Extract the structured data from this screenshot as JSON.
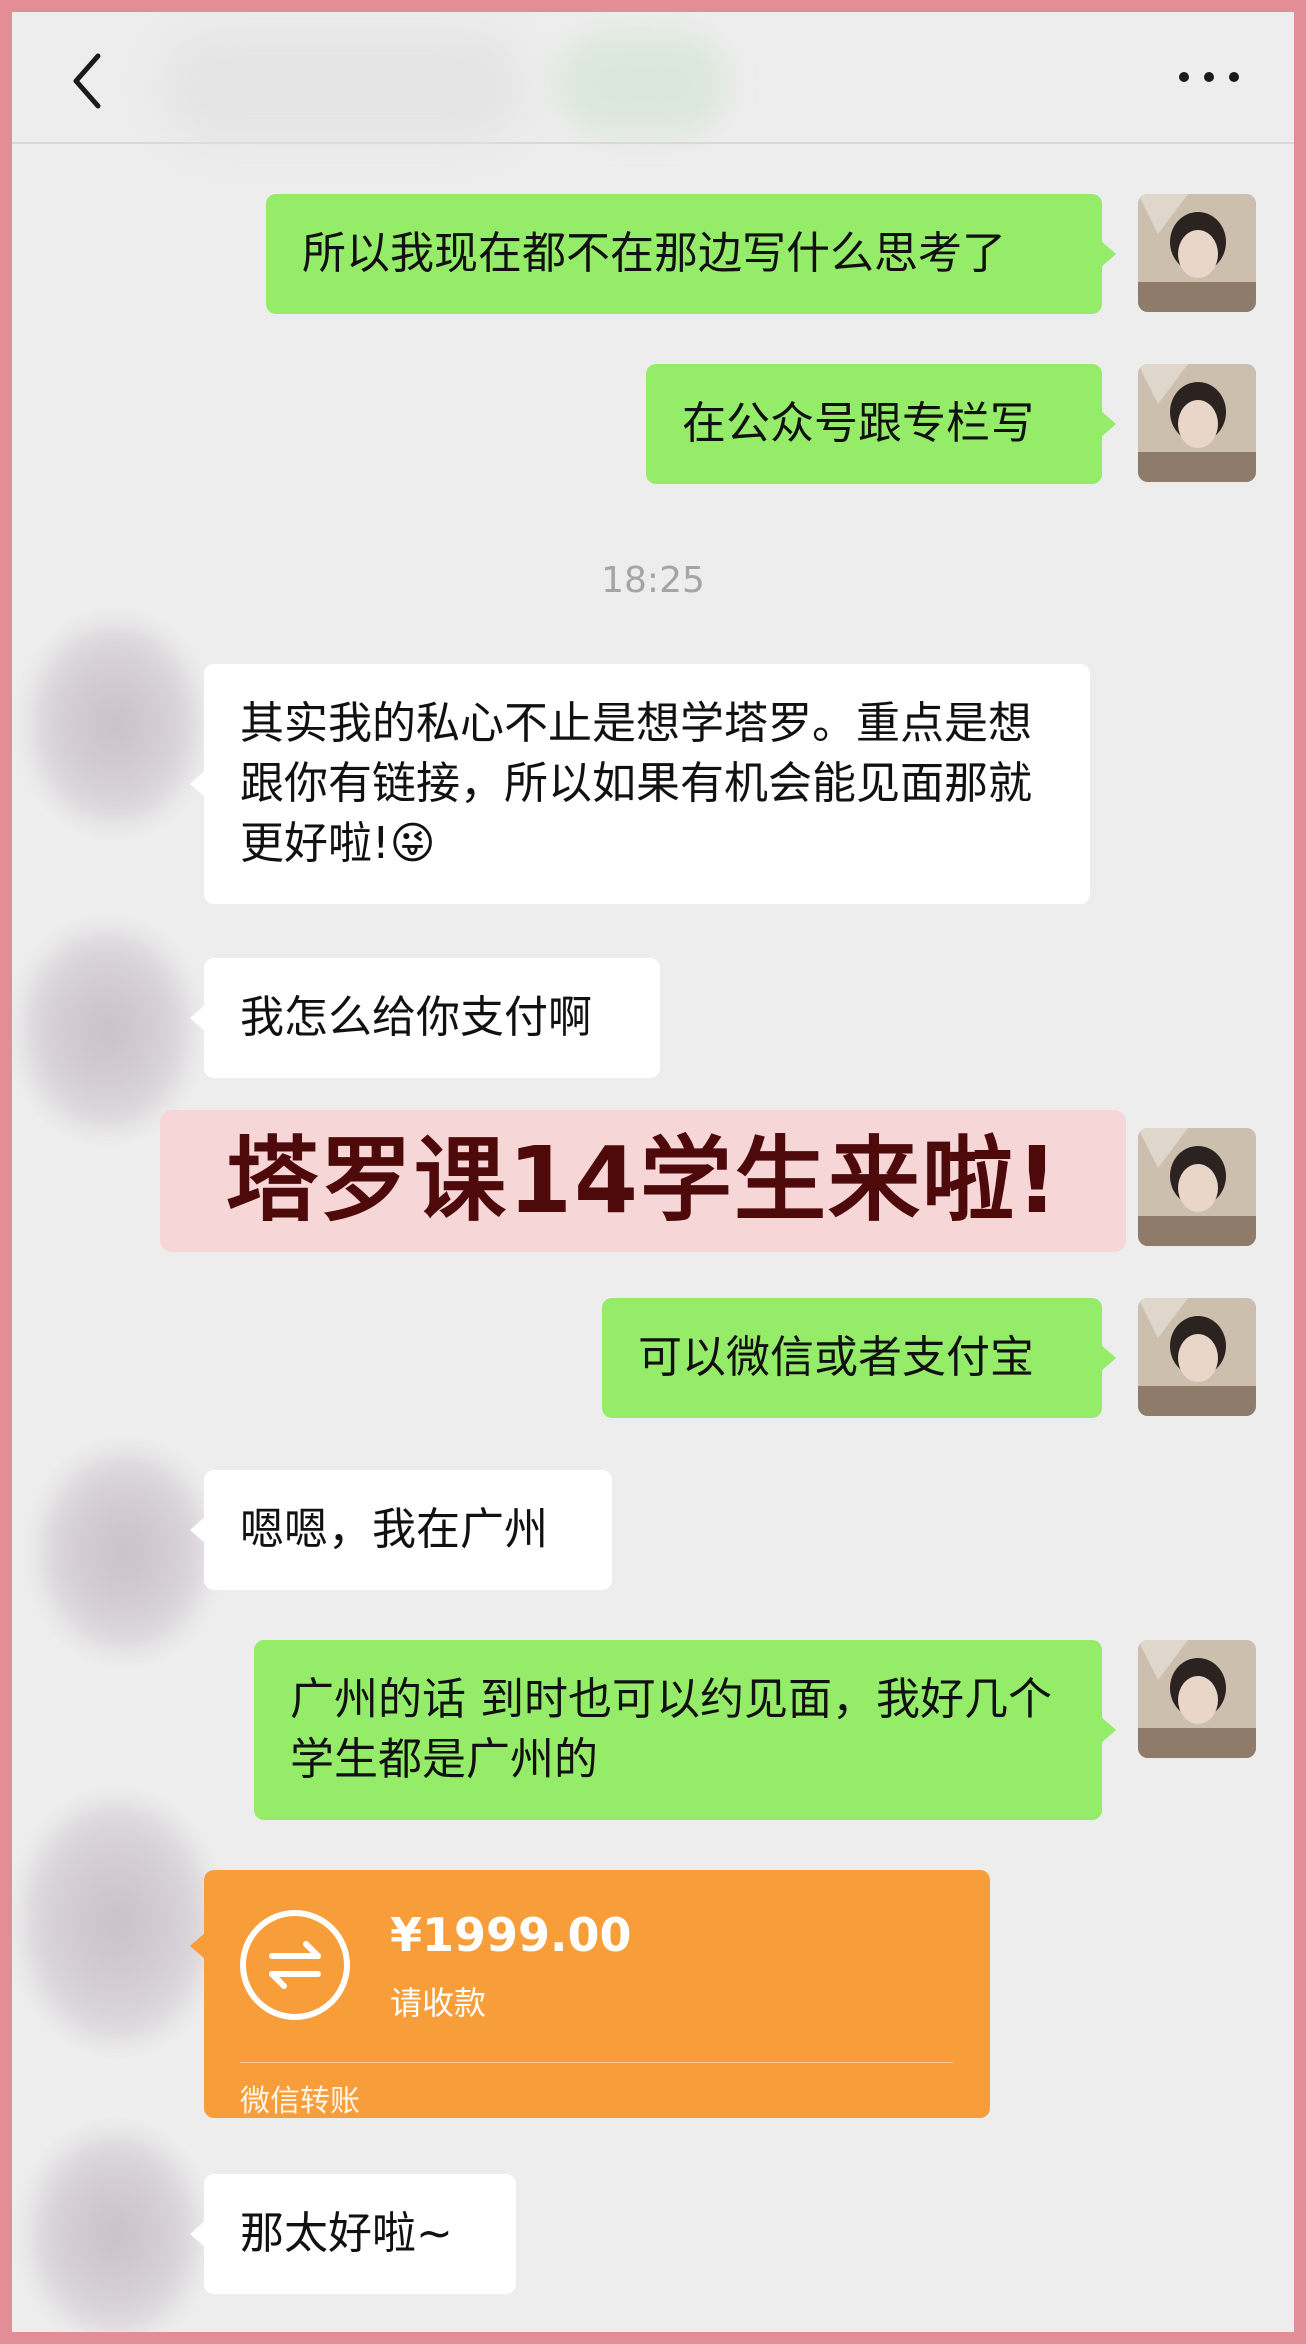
{
  "header": {
    "back_icon": "chevron-left-icon",
    "more_icon": "more-dots-icon"
  },
  "messages": [
    {
      "side": "out",
      "text": "所以我现在都不在那边写什么思考了"
    },
    {
      "side": "out",
      "text": "在公众号跟专栏写"
    },
    {
      "side": "in",
      "text": "其实我的私心不止是想学塔罗。重点是想跟你有链接，所以如果有机会能见面那就更好啦!😜"
    },
    {
      "side": "in",
      "text": "我怎么给你支付啊"
    },
    {
      "side": "out",
      "text": "可以微信或者支付宝"
    },
    {
      "side": "in",
      "text": "嗯嗯，我在广州"
    },
    {
      "side": "out",
      "text": "广州的话 到时也可以约见面，我好几个学生都是广州的"
    },
    {
      "side": "in",
      "text": "那太好啦~"
    }
  ],
  "timestamp": "18:25",
  "banner": "塔罗课14学生来啦!",
  "transfer": {
    "amount": "¥1999.00",
    "status": "请收款",
    "footer": "微信转账",
    "icon": "transfer-arrows-icon"
  },
  "colors": {
    "frame_border": "#e38e96",
    "chat_background": "#ededed",
    "outgoing_bubble": "#95ec69",
    "incoming_bubble": "#ffffff",
    "transfer_card": "#f79e3b",
    "banner_background": "#f6d6d6",
    "banner_text": "#4e0a0a"
  }
}
